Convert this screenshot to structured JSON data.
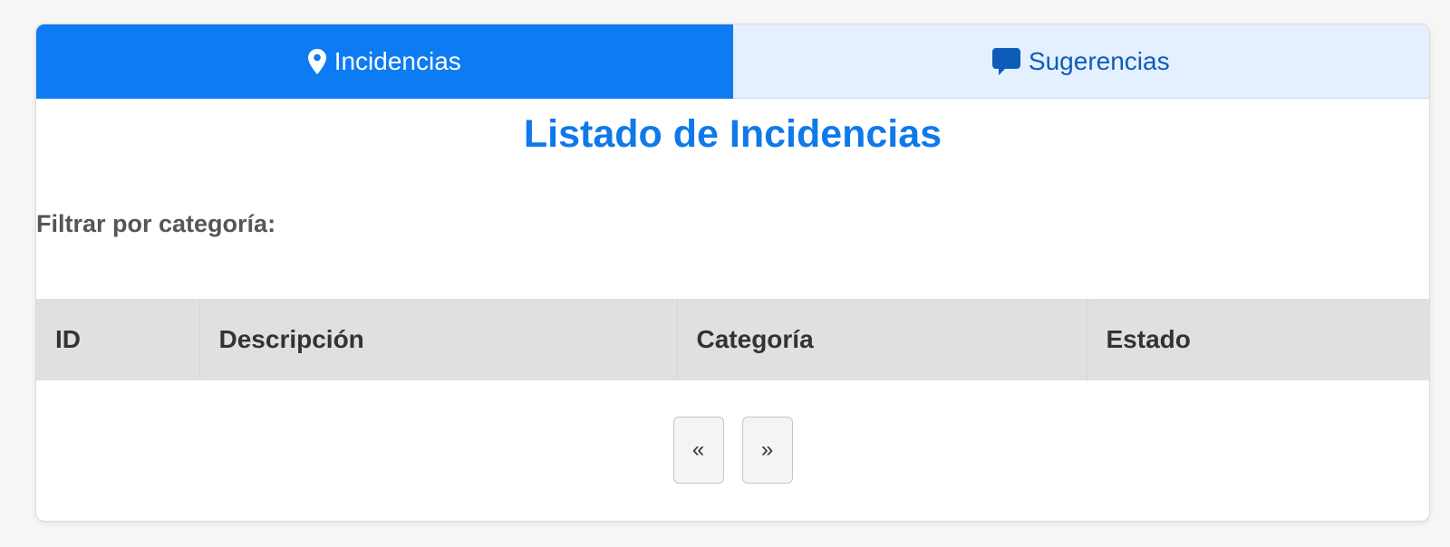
{
  "tabs": [
    {
      "label": "Incidencias",
      "icon": "map-pin-icon",
      "active": true
    },
    {
      "label": "Sugerencias",
      "icon": "comment-icon",
      "active": false
    }
  ],
  "main": {
    "title": "Listado de Incidencias",
    "filter_label": "Filtrar por categoría:"
  },
  "table": {
    "headers": [
      "ID",
      "Descripción",
      "Categoría",
      "Estado"
    ],
    "rows": []
  },
  "pagination": {
    "prev": "«",
    "next": "»"
  },
  "colors": {
    "accent": "#0d7cf2",
    "title": "#1079ea",
    "inactive_tab_bg": "#e4efff",
    "inactive_tab_text": "#0d5db8",
    "table_header_bg": "#e0e0e0"
  }
}
